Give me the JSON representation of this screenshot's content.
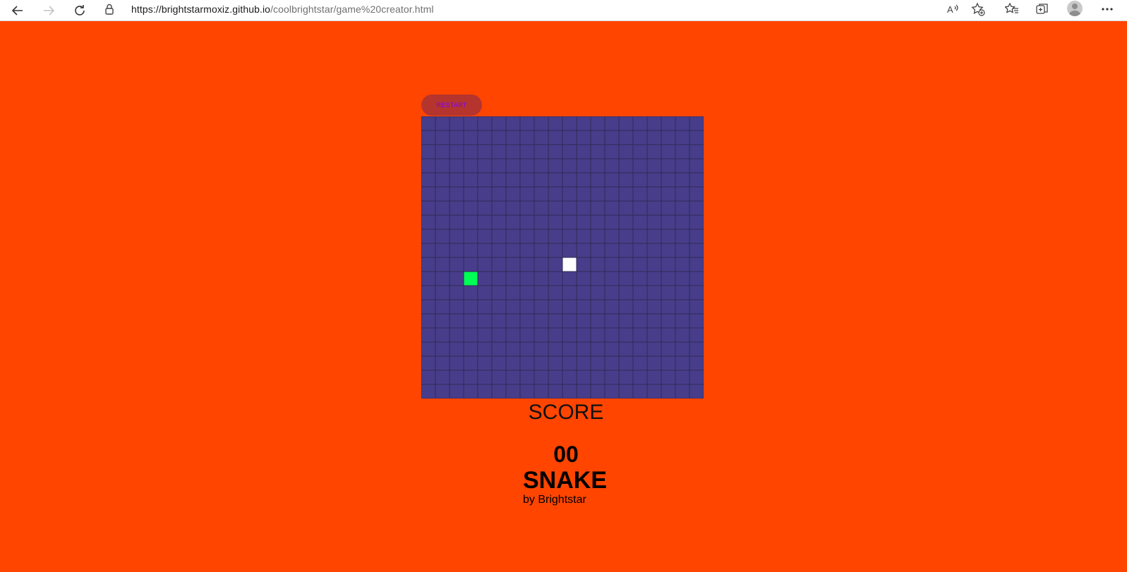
{
  "browser": {
    "url_host": "https://brightstarmoxiz.github.io",
    "url_path": "/coolbrightstar/game%20creator.html",
    "icons": [
      "back-icon",
      "forward-icon",
      "refresh-icon",
      "lock-icon",
      "read-aloud-icon",
      "add-favorite-icon",
      "favorites-icon",
      "collections-icon",
      "profile-icon",
      "more-icon"
    ]
  },
  "game": {
    "restart_label": "RESTART",
    "score_label": "SCORE",
    "score_value": "00",
    "title": "SNAKE",
    "byline": "by Brightstar",
    "board": {
      "columns": 20,
      "rows": 20,
      "snake_head": {
        "col": 3,
        "row": 11
      },
      "food": {
        "col": 10,
        "row": 10
      }
    }
  },
  "colors": {
    "page_background": "#ff4500",
    "board_cell": "#483d8b",
    "grid_line": "#2e2a55",
    "snake": "#00ff55",
    "food": "#ffffff",
    "restart_background": "#b5342e",
    "restart_text": "#7a00ff"
  }
}
